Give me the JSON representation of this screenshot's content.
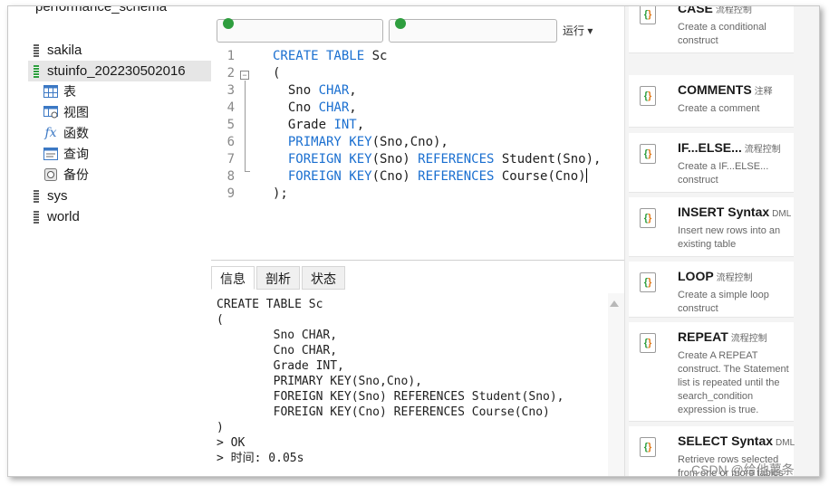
{
  "navigator": {
    "cut_item": "performance_schema",
    "databases": [
      {
        "name": "sakila"
      },
      {
        "name": "stuinfo_202230502016"
      },
      {
        "name": "sys"
      },
      {
        "name": "world"
      }
    ],
    "objects": [
      {
        "label": "表",
        "icon": "table-icon"
      },
      {
        "label": "视图",
        "icon": "view-icon"
      },
      {
        "label": "函数",
        "icon": "function-icon"
      },
      {
        "label": "查询",
        "icon": "query-icon"
      },
      {
        "label": "备份",
        "icon": "backup-icon"
      }
    ]
  },
  "editor": {
    "toolbar_more": "运行 ▾",
    "line_numbers": [
      "1",
      "2",
      "3",
      "4",
      "5",
      "6",
      "7",
      "8",
      "9"
    ],
    "lines": [
      [
        {
          "t": "CREATE TABLE",
          "c": "kw"
        },
        {
          "t": " Sc",
          "c": "id"
        }
      ],
      [
        {
          "t": "(",
          "c": "id"
        }
      ],
      [
        {
          "t": "  Sno ",
          "c": "id"
        },
        {
          "t": "CHAR",
          "c": "ty"
        },
        {
          "t": ",",
          "c": "id"
        }
      ],
      [
        {
          "t": "  Cno ",
          "c": "id"
        },
        {
          "t": "CHAR",
          "c": "ty"
        },
        {
          "t": ",",
          "c": "id"
        }
      ],
      [
        {
          "t": "  Grade ",
          "c": "id"
        },
        {
          "t": "INT",
          "c": "ty"
        },
        {
          "t": ",",
          "c": "id"
        }
      ],
      [
        {
          "t": "  PRIMARY KEY",
          "c": "kw"
        },
        {
          "t": "(Sno,Cno),",
          "c": "id"
        }
      ],
      [
        {
          "t": "  FOREIGN KEY",
          "c": "kw"
        },
        {
          "t": "(Sno) ",
          "c": "id"
        },
        {
          "t": "REFERENCES",
          "c": "kw"
        },
        {
          "t": " Student(Sno),",
          "c": "id"
        }
      ],
      [
        {
          "t": "  FOREIGN KEY",
          "c": "kw"
        },
        {
          "t": "(Cno) ",
          "c": "id"
        },
        {
          "t": "REFERENCES",
          "c": "kw"
        },
        {
          "t": " Course(Cno)",
          "c": "id"
        }
      ],
      [
        {
          "t": ");",
          "c": "id"
        }
      ]
    ]
  },
  "output": {
    "tabs": [
      "信息",
      "剖析",
      "状态"
    ],
    "active_tab": "信息",
    "lines": [
      "CREATE TABLE Sc",
      "(",
      "        Sno CHAR,",
      "        Cno CHAR,",
      "        Grade INT,",
      "        PRIMARY KEY(Sno,Cno),",
      "        FOREIGN KEY(Sno) REFERENCES Student(Sno),",
      "        FOREIGN KEY(Cno) REFERENCES Course(Cno)",
      ")",
      "> OK",
      "> 时间: 0.05s"
    ]
  },
  "snippets": [
    {
      "title": "CASE",
      "tag": "流程控制",
      "desc": "Create a conditional construct"
    },
    {
      "title": "COMMENTS",
      "tag": "注释",
      "desc": "Create a comment"
    },
    {
      "title": "IF...ELSE...",
      "tag": "流程控制",
      "desc": "Create a IF...ELSE... construct"
    },
    {
      "title": "INSERT Syntax",
      "tag": "DML",
      "desc": "Insert new rows into an existing table"
    },
    {
      "title": "LOOP",
      "tag": "流程控制",
      "desc": "Create a simple loop construct"
    },
    {
      "title": "REPEAT",
      "tag": "流程控制",
      "desc": "Create A REPEAT construct. The Statement list is repeated until the search_condition expression is true."
    },
    {
      "title": "SELECT Syntax",
      "tag": "DML",
      "desc": "Retrieve rows selected from one or more tables"
    }
  ],
  "watermark": "CSDN @给他薯条",
  "colors": {
    "keyword": "#1a6fd0",
    "db_active": "#2e9e3e",
    "snippet_left": "#2e9e3e",
    "snippet_right": "#e07a1a"
  }
}
